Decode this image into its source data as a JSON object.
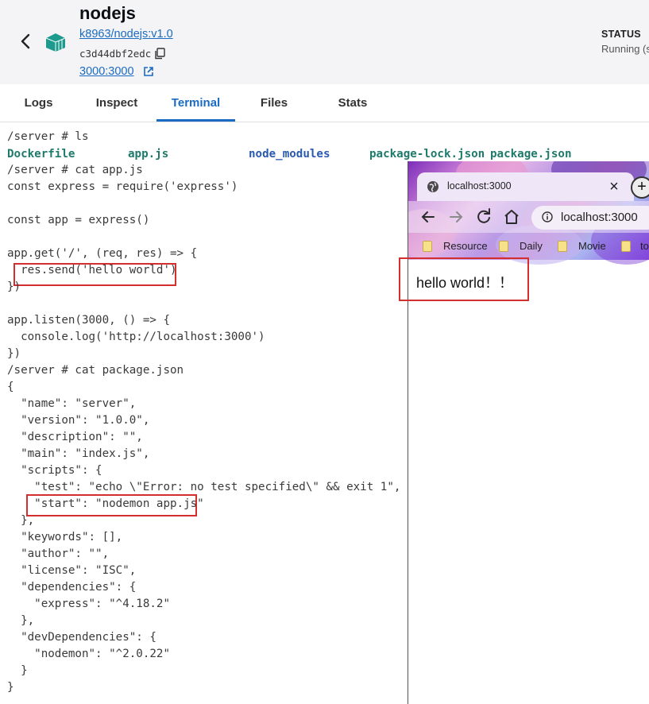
{
  "header": {
    "title": "nodejs",
    "image_link": "k8963/nodejs:v1.0",
    "container_id": "c3d44dbf2edc",
    "port_link": "3000:3000",
    "status_label": "STATUS",
    "status_value": "Running (s"
  },
  "tabs": [
    {
      "label": "Logs",
      "active": false
    },
    {
      "label": "Inspect",
      "active": false
    },
    {
      "label": "Terminal",
      "active": true
    },
    {
      "label": "Files",
      "active": false
    },
    {
      "label": "Stats",
      "active": false
    }
  ],
  "terminal": {
    "prompt_ls": "/server # ls",
    "ls_items": [
      "Dockerfile",
      "app.js",
      "node_modules",
      "package-lock.json",
      "package.json"
    ],
    "lines": [
      "/server # cat app.js",
      "const express = require('express')",
      "",
      "const app = express()",
      "",
      "app.get('/', (req, res) => {",
      "  res.send('hello world')",
      "})",
      "",
      "app.listen(3000, () => {",
      "  console.log('http://localhost:3000')",
      "})",
      "/server # cat package.json",
      "{",
      "  \"name\": \"server\",",
      "  \"version\": \"1.0.0\",",
      "  \"description\": \"\",",
      "  \"main\": \"index.js\",",
      "  \"scripts\": {",
      "    \"test\": \"echo \\\"Error: no test specified\\\" && exit 1\",",
      "    \"start\": \"nodemon app.js\"",
      "  },",
      "  \"keywords\": [],",
      "  \"author\": \"\",",
      "  \"license\": \"ISC\",",
      "  \"dependencies\": {",
      "    \"express\": \"^4.18.2\"",
      "  },",
      "  \"devDependencies\": {",
      "    \"nodemon\": \"^2.0.22\"",
      "  }",
      "}"
    ]
  },
  "browser": {
    "tab_title": "localhost:3000",
    "close_glyph": "×",
    "newtab_glyph": "+",
    "url": "localhost:3000",
    "bookmarks": [
      "Resource",
      "Daily",
      "Movie",
      "to"
    ],
    "page_text": "hello world！！"
  },
  "colors": {
    "accent": "#1a6bc1",
    "highlight": "#d32f2f",
    "ls_file": "#1e7a6b",
    "ls_dir": "#2a59b0"
  }
}
